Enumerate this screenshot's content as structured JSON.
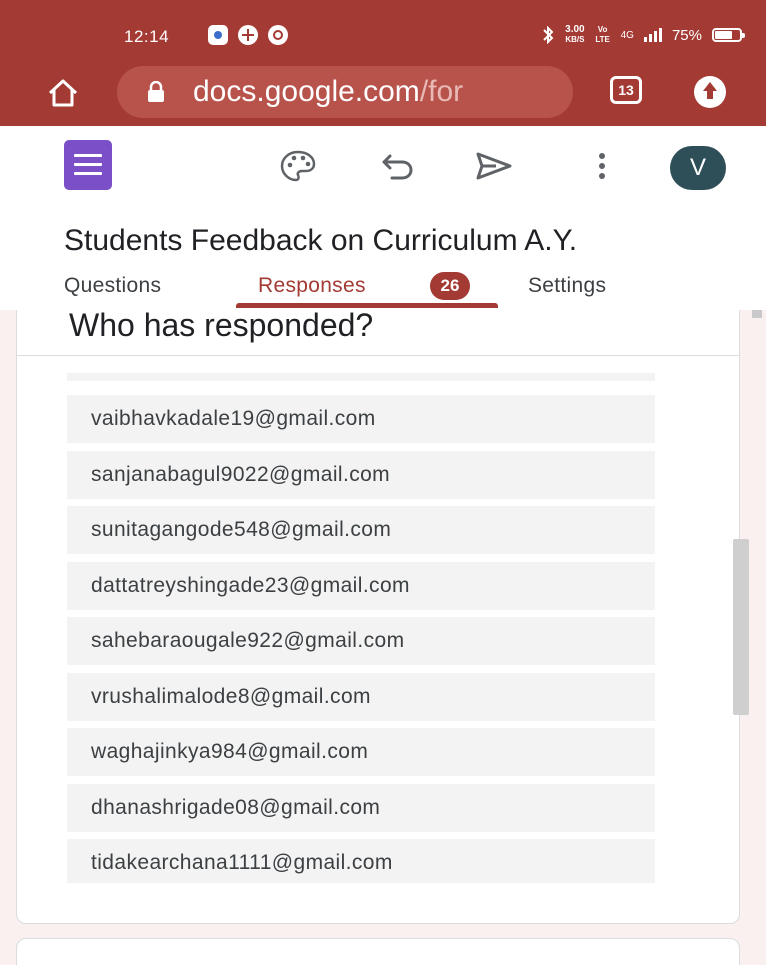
{
  "status_bar": {
    "time": "12:14",
    "net_speed": "3.00",
    "net_unit": "KB/S",
    "volte": "Vo LTE",
    "network": "4G",
    "battery": "75%"
  },
  "browser": {
    "url_main": "docs.google.com",
    "url_faded": "/for",
    "tab_count": "13"
  },
  "toolbar": {
    "avatar_letter": "V"
  },
  "form": {
    "title": "Students Feedback on Curriculum A.Y.",
    "tabs": {
      "questions": "Questions",
      "responses": "Responses",
      "responses_count": "26",
      "settings": "Settings"
    }
  },
  "responders": {
    "heading": "Who has responded?",
    "emails": [
      "vaibhavkadale19@gmail.com",
      "sanjanabagul9022@gmail.com",
      "sunitagangode548@gmail.com",
      "dattatreyshingade23@gmail.com",
      "sahebaraougale922@gmail.com",
      "vrushalimalode8@gmail.com",
      "waghajinkya984@gmail.com",
      "dhanashrigade08@gmail.com",
      "tidakearchana1111@gmail.com"
    ]
  },
  "colors": {
    "accent": "#a33a34",
    "forms_purple": "#7a4fc7",
    "avatar_bg": "#2f4f58"
  }
}
